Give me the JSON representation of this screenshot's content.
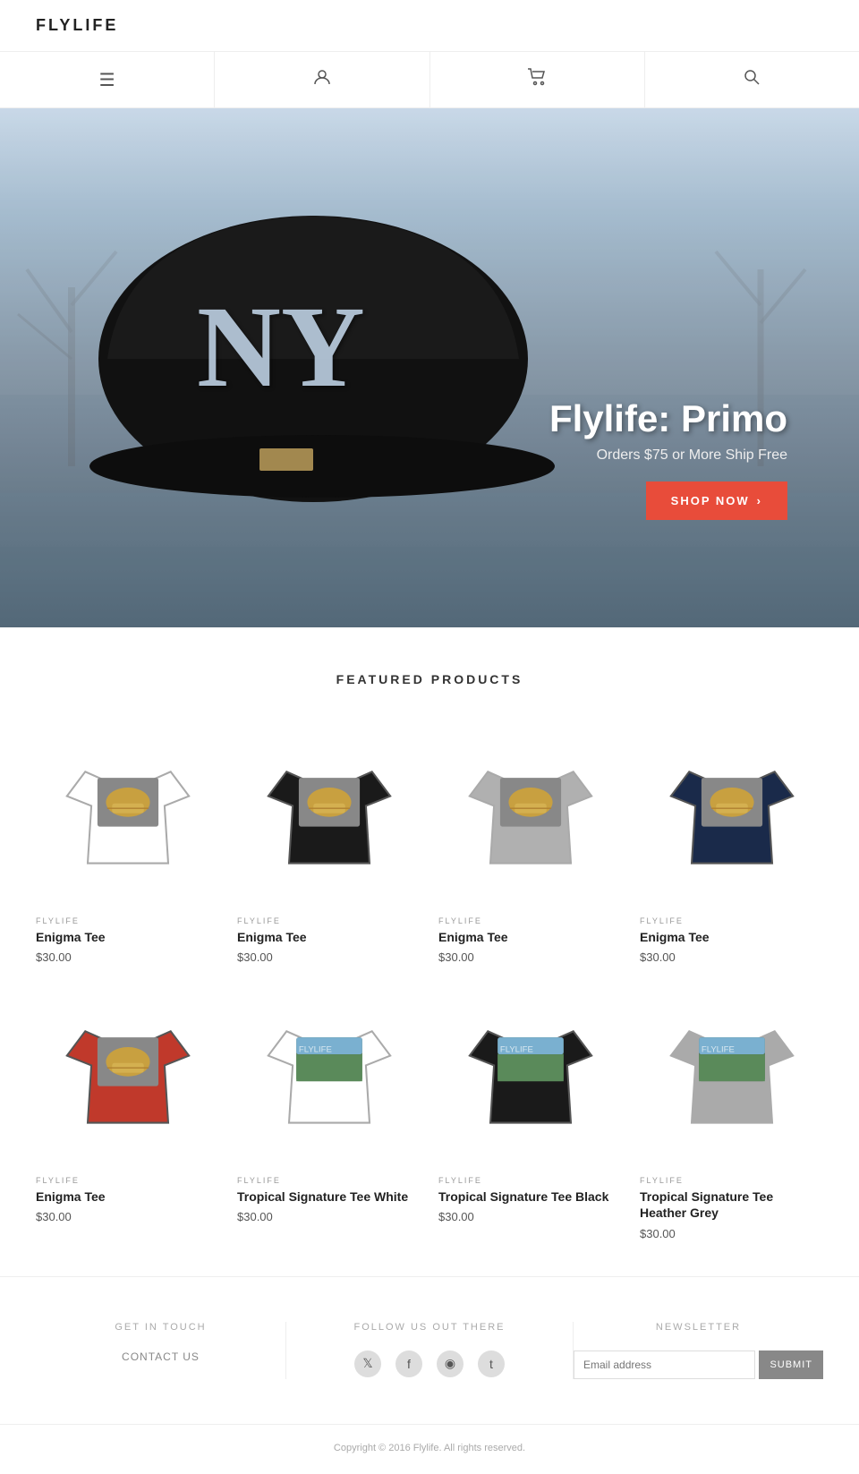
{
  "header": {
    "logo": "FLYLIFE"
  },
  "nav": {
    "items": [
      {
        "icon": "≡",
        "label": "menu-icon"
      },
      {
        "icon": "👤",
        "label": "account-icon"
      },
      {
        "icon": "🛒",
        "label": "cart-icon"
      },
      {
        "icon": "🔍",
        "label": "search-icon"
      }
    ]
  },
  "hero": {
    "title": "Flylife: Primo",
    "subtitle": "Orders $75 or More Ship Free",
    "cta_label": "SHOP NOW",
    "cta_arrow": "›"
  },
  "featured": {
    "section_title": "FEATURED PRODUCTS",
    "products": [
      {
        "brand": "FLYLIFE",
        "name": "Enigma Tee",
        "price": "$30.00",
        "color": "#ffffff",
        "text_color": "#222"
      },
      {
        "brand": "FLYLIFE",
        "name": "Enigma Tee",
        "price": "$30.00",
        "color": "#1a1a1a",
        "text_color": "#fff"
      },
      {
        "brand": "FLYLIFE",
        "name": "Enigma Tee",
        "price": "$30.00",
        "color": "#b0b0b0",
        "text_color": "#555"
      },
      {
        "brand": "FLYLIFE",
        "name": "Enigma Tee",
        "price": "$30.00",
        "color": "#1a2a4a",
        "text_color": "#fff"
      },
      {
        "brand": "FLYLIFE",
        "name": "Enigma Tee",
        "price": "$30.00",
        "color": "#c0392b",
        "text_color": "#fff"
      },
      {
        "brand": "FLYLIFE",
        "name": "Tropical Signature Tee White",
        "price": "$30.00",
        "color": "#ffffff",
        "text_color": "#222"
      },
      {
        "brand": "FLYLIFE",
        "name": "Tropical Signature Tee Black",
        "price": "$30.00",
        "color": "#1a1a1a",
        "text_color": "#fff"
      },
      {
        "brand": "FLYLIFE",
        "name": "Tropical Signature Tee Heather Grey",
        "price": "$30.00",
        "color": "#aaaaaa",
        "text_color": "#555"
      }
    ]
  },
  "footer": {
    "get_in_touch": {
      "heading": "GET IN TOUCH",
      "contact_label": "CONTACT US"
    },
    "follow": {
      "heading": "FOLLOW US OUT THERE",
      "social_icons": [
        "𝕏",
        "f",
        "📷",
        "t"
      ]
    },
    "newsletter": {
      "heading": "NEWSLETTER",
      "email_placeholder": "Email address",
      "submit_label": "SUBMIT"
    },
    "copyright": "Copyright © 2016 Flylife. All rights reserved."
  }
}
